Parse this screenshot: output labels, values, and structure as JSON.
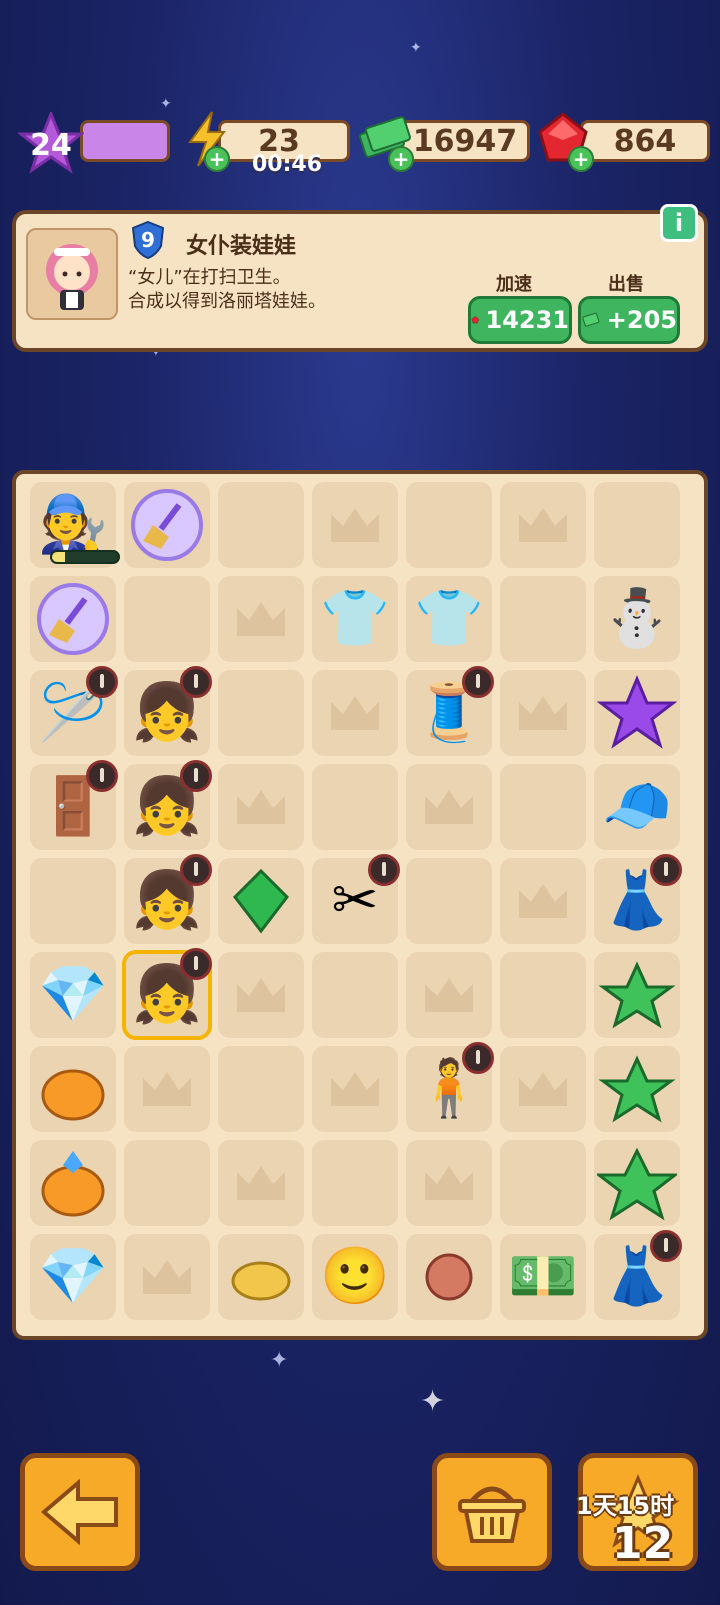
{
  "hud": {
    "level": "24",
    "energy": "23",
    "energy_timer": "00:46",
    "cash": "16947",
    "gems": "864"
  },
  "info": {
    "item_level": "9",
    "item_title": "女仆装娃娃",
    "desc_line1": "“女儿”在打扫卫生。",
    "desc_line2": "合成以得到洛丽塔娃娃。",
    "speedup_label": "加速",
    "sell_label": "出售",
    "speedup_cost": "14231",
    "sell_value": "+205",
    "help_label": "i"
  },
  "board": {
    "rows": [
      [
        "worker",
        "broom_bubble",
        "empty",
        "crown",
        "empty",
        "crown",
        "empty"
      ],
      [
        "broom_bubble",
        "empty",
        "crown",
        "pajamas",
        "pajamas",
        "empty",
        "snowman"
      ],
      [
        "sewing_station",
        "doll_basic",
        "empty",
        "crown",
        "sewing_machine",
        "crown",
        "purple_star"
      ],
      [
        "wardrobe",
        "doll_yellow",
        "crown",
        "empty",
        "crown",
        "empty",
        "snow_cap"
      ],
      [
        "empty",
        "doll_lolita",
        "green_gem",
        "scissors",
        "empty",
        "crown",
        "pink_dress"
      ],
      [
        "jewel_necklace",
        "doll_maid",
        "crown",
        "empty",
        "crown",
        "empty",
        "angel_star"
      ],
      [
        "pumpkin",
        "crown",
        "empty",
        "crown",
        "mannequin",
        "crown",
        "angel_star_plus"
      ],
      [
        "pumpkin_jewel",
        "empty",
        "crown",
        "empty",
        "crown",
        "empty",
        "angel_star_big"
      ],
      [
        "jewel_necklace",
        "crown",
        "tape",
        "doll_head",
        "button",
        "cash_pile",
        "blue_gown"
      ]
    ],
    "worker_progress": 0.2
  },
  "bottom": {
    "event_time": "1天15时",
    "event_count": "12"
  },
  "colors": {
    "panel": "#f6e3c3",
    "panel_border": "#6a4528",
    "accent_green": "#3fb55f",
    "button_orange": "#f7a928"
  }
}
